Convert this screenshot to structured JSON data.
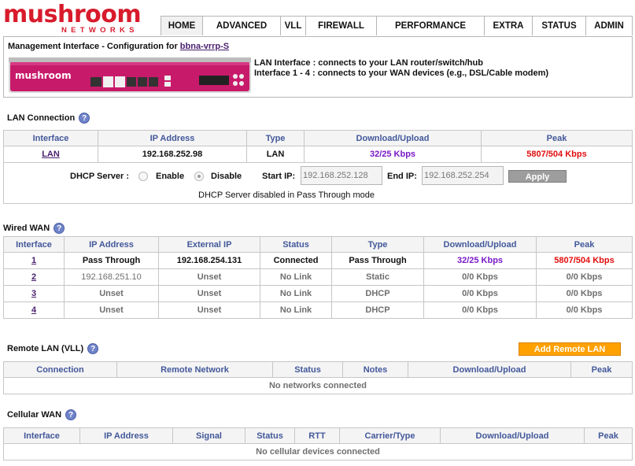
{
  "logo": {
    "word": "mushroom",
    "sub": "NETWORKS"
  },
  "nav": {
    "tabs": [
      {
        "label": "HOME",
        "active": true
      },
      {
        "label": "ADVANCED"
      },
      {
        "label": "VLL"
      },
      {
        "label": "FIREWALL"
      },
      {
        "label": "PERFORMANCE"
      },
      {
        "label": "EXTRA"
      },
      {
        "label": "STATUS"
      },
      {
        "label": "ADMIN"
      }
    ]
  },
  "management": {
    "title_prefix": "Management Interface - Configuration for ",
    "device_name": "bbna-vrrp-S",
    "device_brand": "mushroom",
    "lan_desc": "LAN Interface : connects to your LAN router/switch/hub",
    "wan_desc": "Interface 1 - 4 : connects to your WAN devices (e.g., DSL/Cable modem)"
  },
  "lan": {
    "title": "LAN Connection",
    "help": "?",
    "headers": [
      "Interface",
      "IP Address",
      "Type",
      "Download/Upload",
      "Peak"
    ],
    "row": {
      "interface": "LAN",
      "ip": "192.168.252.98",
      "type": "LAN",
      "dlul": "32/25 Kbps",
      "peak": "5807/504 Kbps"
    },
    "dhcp": {
      "label": "DHCP Server :",
      "enable_label": "Enable",
      "disable_label": "Disable",
      "selected": "Disable",
      "start_label": "Start IP:",
      "start_value": "192.168.252.128",
      "end_label": "End IP:",
      "end_value": "192.168.252.254",
      "apply_label": "Apply",
      "note": "DHCP Server disabled in Pass Through mode"
    }
  },
  "wired_wan": {
    "title": "Wired WAN",
    "help": "?",
    "headers": [
      "Interface",
      "IP Address",
      "External IP",
      "Status",
      "Type",
      "Download/Upload",
      "Peak"
    ],
    "rows": [
      {
        "interface": "1",
        "ip": "Pass Through",
        "ext": "192.168.254.131",
        "status": "Connected",
        "type": "Pass Through",
        "dlul": "32/25 Kbps",
        "peak": "5807/504 Kbps",
        "active": true
      },
      {
        "interface": "2",
        "ip": "192.168.251.10",
        "ext": "Unset",
        "status": "No Link",
        "type": "Static",
        "dlul": "0/0 Kbps",
        "peak": "0/0 Kbps"
      },
      {
        "interface": "3",
        "ip": "Unset",
        "ext": "Unset",
        "status": "No Link",
        "type": "DHCP",
        "dlul": "0/0 Kbps",
        "peak": "0/0 Kbps"
      },
      {
        "interface": "4",
        "ip": "Unset",
        "ext": "Unset",
        "status": "No Link",
        "type": "DHCP",
        "dlul": "0/0 Kbps",
        "peak": "0/0 Kbps"
      }
    ]
  },
  "remote_lan": {
    "title": "Remote LAN (VLL)",
    "help": "?",
    "add_label": "Add Remote LAN",
    "headers": [
      "Connection",
      "Remote Network",
      "Status",
      "Notes",
      "Download/Upload",
      "Peak"
    ],
    "empty": "No networks connected"
  },
  "cellular_wan": {
    "title": "Cellular WAN",
    "help": "?",
    "headers": [
      "Interface",
      "IP Address",
      "Signal",
      "Status",
      "RTT",
      "Carrier/Type",
      "Download/Upload",
      "Peak"
    ],
    "empty": "No cellular devices connected"
  },
  "colors": {
    "brand_red": "#d81b2c",
    "header_text": "#42589a",
    "throughput": "#7a18c8",
    "peak": "#e20d0d",
    "device_body": "#c81a6a",
    "add_button": "#ffa100"
  }
}
